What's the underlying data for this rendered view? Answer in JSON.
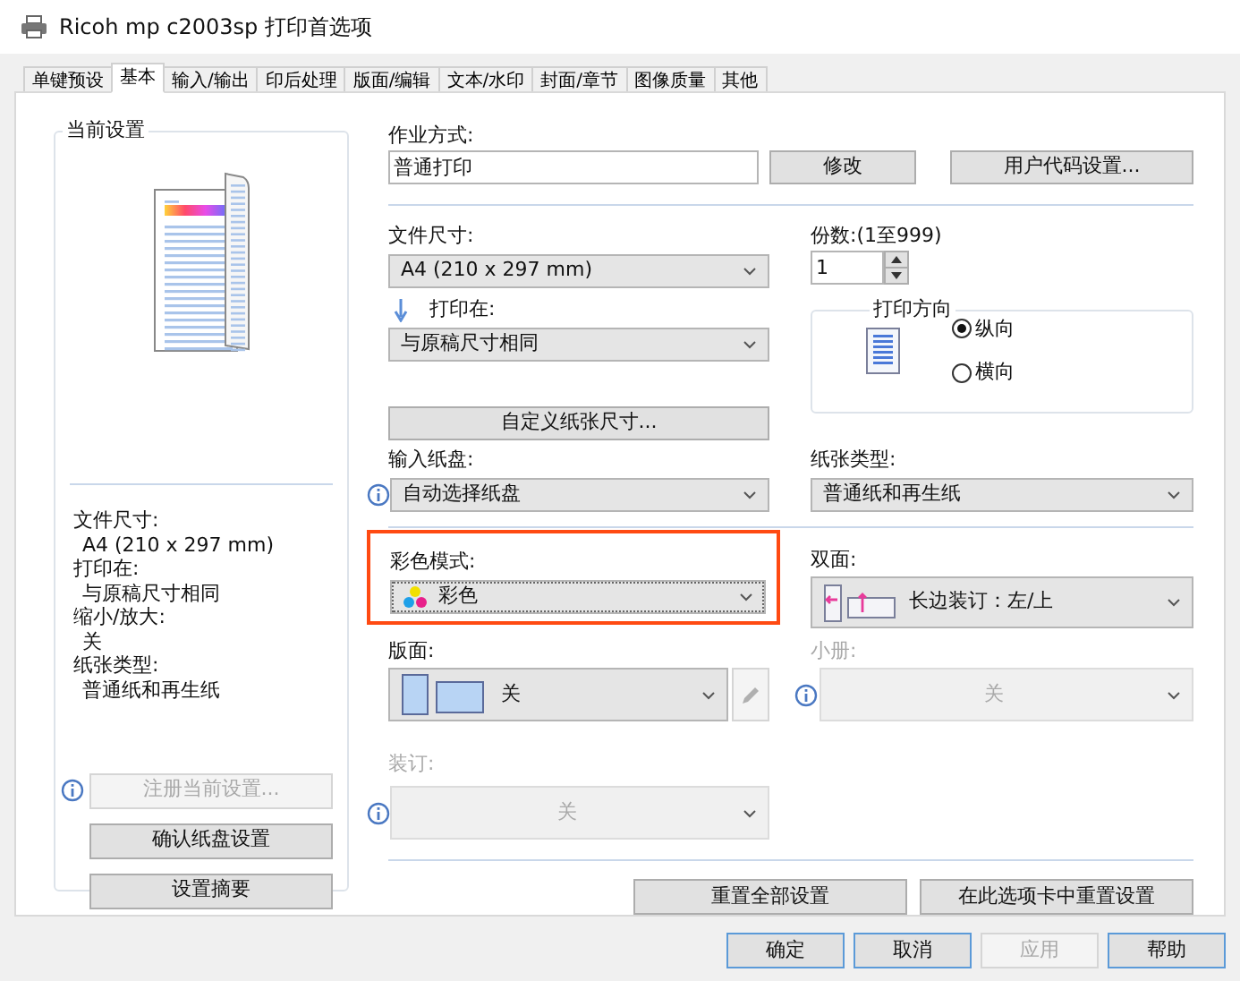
{
  "window": {
    "title": "Ricoh mp c2003sp 打印首选项"
  },
  "tabs": [
    {
      "label": "单键预设",
      "selected": false
    },
    {
      "label": "基本",
      "selected": true
    },
    {
      "label": "输入/输出",
      "selected": false
    },
    {
      "label": "印后处理",
      "selected": false
    },
    {
      "label": "版面/编辑",
      "selected": false
    },
    {
      "label": "文本/水印",
      "selected": false
    },
    {
      "label": "封面/章节",
      "selected": false
    },
    {
      "label": "图像质量",
      "selected": false
    },
    {
      "label": "其他",
      "selected": false
    }
  ],
  "current_settings": {
    "title": "当前设置",
    "summary": [
      {
        "label": "文件尺寸:",
        "value": "A4 (210 x 297 mm)"
      },
      {
        "label": "打印在:",
        "value": "与原稿尺寸相同"
      },
      {
        "label": "缩小/放大:",
        "value": "关"
      },
      {
        "label": "纸张类型:",
        "value": "普通纸和再生纸"
      }
    ],
    "buttons": [
      {
        "label": "注册当前设置...",
        "disabled": true,
        "kind": "info"
      },
      {
        "label": "确认纸盘设置",
        "disabled": false,
        "kind": "plain"
      },
      {
        "label": "设置摘要",
        "disabled": false,
        "kind": "plain"
      }
    ]
  },
  "job_mode": {
    "label": "作业方式:",
    "value": "普通打印",
    "buttons": [
      "修改",
      "用户代码设置..."
    ]
  },
  "document_size": {
    "label": "文件尺寸:",
    "value": "A4 (210 x 297 mm)"
  },
  "copies": {
    "label": "份数:(1至999)",
    "value": "1"
  },
  "print_on": {
    "label": "打印在:",
    "value": "与原稿尺寸相同"
  },
  "orientation": {
    "title": "打印方向",
    "options": [
      {
        "label": "纵向",
        "selected": true
      },
      {
        "label": "横向",
        "selected": false
      }
    ]
  },
  "custom_size_button": "自定义纸张尺寸...",
  "input_tray": {
    "label": "输入纸盘:",
    "value": "自动选择纸盘"
  },
  "paper_type": {
    "label": "纸张类型:",
    "value": "普通纸和再生纸"
  },
  "color_mode": {
    "label": "彩色模式:",
    "value": "彩色",
    "highlighted": true
  },
  "duplex": {
    "label": "双面:",
    "value": "长边装订：左/上"
  },
  "layout": {
    "label": "版面:",
    "value": "关"
  },
  "booklet": {
    "label": "小册:",
    "value": "关",
    "disabled": true
  },
  "binding": {
    "label": "装订:",
    "value": "关",
    "disabled": true
  },
  "reset_buttons": [
    "重置全部设置",
    "在此选项卡中重置设置"
  ],
  "dialog_buttons": [
    {
      "label": "确定",
      "disabled": false
    },
    {
      "label": "取消",
      "disabled": false
    },
    {
      "label": "应用",
      "disabled": true
    },
    {
      "label": "帮助",
      "disabled": false
    }
  ]
}
